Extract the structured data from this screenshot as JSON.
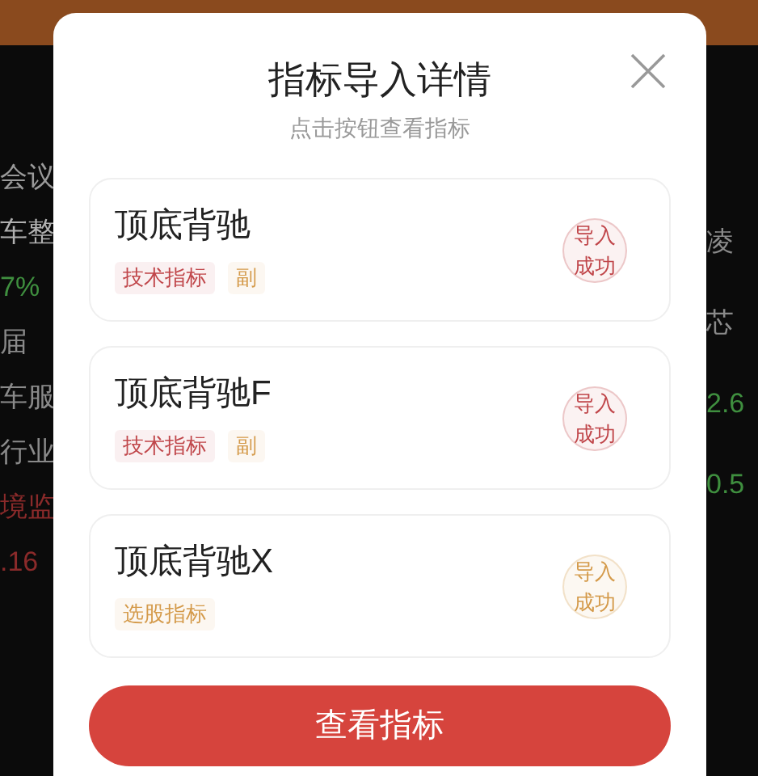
{
  "background": {
    "left_fragments": [
      {
        "text": "会议",
        "color": "#9a9a9a"
      },
      {
        "text": "车整",
        "color": "#b0b0b0"
      },
      {
        "text": "7%",
        "color": "#3f8f3f"
      },
      {
        "text": "届",
        "color": "#8a8a8a"
      },
      {
        "text": "车服",
        "color": "#8a8a8a"
      },
      {
        "text": "行业",
        "color": "#8a8a8a"
      },
      {
        "text": "境监",
        "color": "#8a2a2a"
      },
      {
        "text": ".16",
        "color": "#8a2a2a"
      }
    ],
    "right_fragments": [
      {
        "text": "凌",
        "color": "#8a8a8a"
      },
      {
        "text": "芯",
        "color": "#8a8a8a"
      },
      {
        "text": "2.6",
        "color": "#3f8f3f"
      },
      {
        "text": "0.5",
        "color": "#3f8f3f"
      }
    ]
  },
  "dialog": {
    "title": "指标导入详情",
    "subtitle": "点击按钮查看指标",
    "items": [
      {
        "name": "顶底背驰",
        "tags": [
          {
            "label": "技术指标",
            "color": "#c0464a"
          },
          {
            "label": "副",
            "color": "#d49a4a"
          }
        ],
        "badge": {
          "label": "导入成功",
          "color": "#c0464a"
        }
      },
      {
        "name": "顶底背驰F",
        "tags": [
          {
            "label": "技术指标",
            "color": "#c0464a"
          },
          {
            "label": "副",
            "color": "#d49a4a"
          }
        ],
        "badge": {
          "label": "导入成功",
          "color": "#c0464a"
        }
      },
      {
        "name": "顶底背驰X",
        "tags": [
          {
            "label": "选股指标",
            "color": "#d49a4a"
          }
        ],
        "badge": {
          "label": "导入成功",
          "color": "#d49a4a"
        }
      }
    ],
    "button": "查看指标"
  }
}
